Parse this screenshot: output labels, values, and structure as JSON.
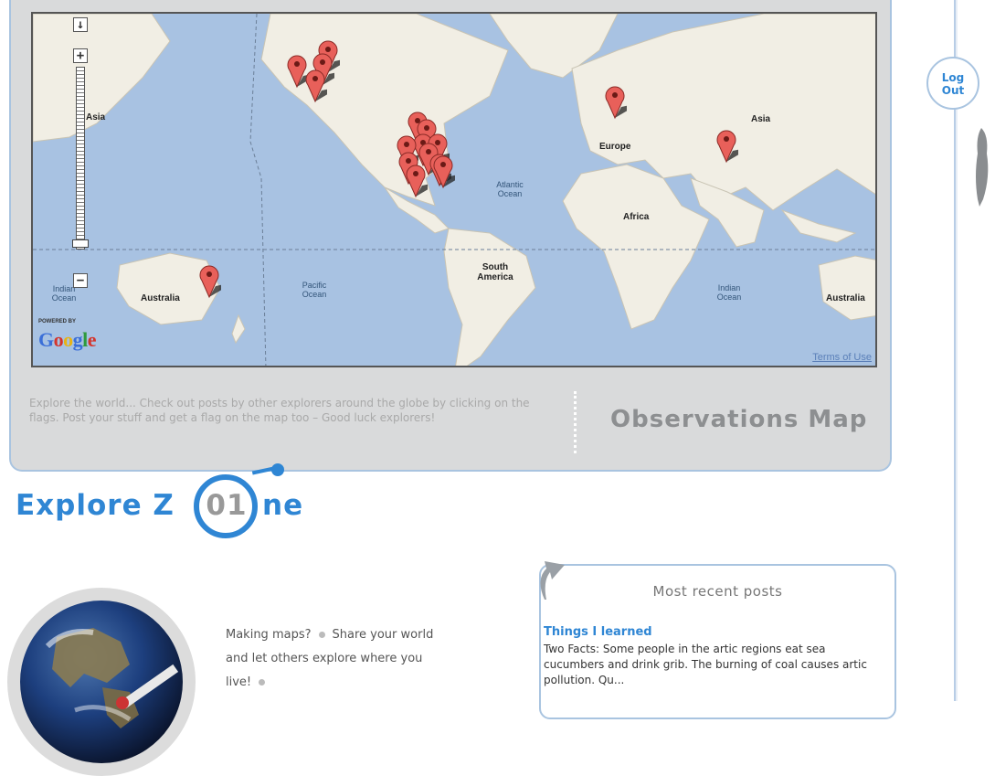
{
  "map": {
    "zoom_in_label": "+",
    "zoom_out_label": "−",
    "pan_label": "↓",
    "region_labels": [
      "Asia",
      "Europe",
      "Asia",
      "Africa",
      "South America",
      "Australia",
      "Australia"
    ],
    "ocean_labels": [
      "Atlantic Ocean",
      "Pacific Ocean",
      "Indian Ocean",
      "Indian Ocean"
    ],
    "powered_by": "POWERED BY",
    "google_logo": "Google",
    "terms_of_use": "Terms of Use",
    "pin_color": "#e8605a"
  },
  "map_panel": {
    "description": "Explore the world... Check out posts by other explorers around the globe by clicking on the flags. Post your stuff and get a flag on the map too – Good luck explorers!",
    "title": "Observations Map"
  },
  "explore_zone": {
    "title_prefix": "Explore Z",
    "zone_number": "01",
    "title_suffix": "ne",
    "accent_color": "#2f86d4"
  },
  "making_maps": {
    "sentences": [
      "Making maps?",
      "Share your world and let others explore where you live!"
    ]
  },
  "recent_posts": {
    "heading": "Most recent posts",
    "items": [
      {
        "title": "Things I learned",
        "excerpt": "Two Facts: Some people in the artic regions eat sea cucumbers and drink grib. The burning of coal causes artic pollution. Qu..."
      }
    ]
  },
  "sidebar": {
    "logout_label_line1": "Log",
    "logout_label_line2": "Out"
  }
}
